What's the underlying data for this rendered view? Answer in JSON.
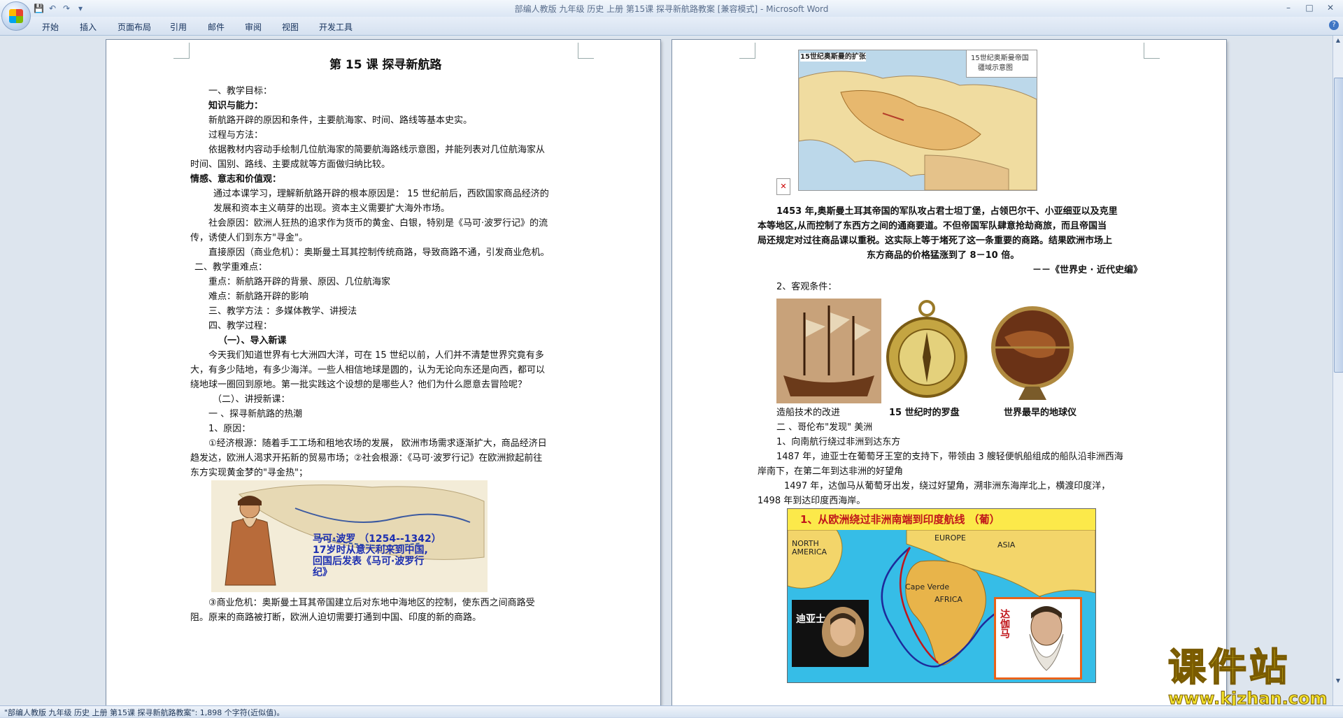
{
  "titlebar": {
    "title": "部编人教版 九年级 历史  上册 第15课  探寻新航路教案 [兼容模式] - Microsoft Word",
    "minimize": "–",
    "maximize": "□",
    "close": "✕"
  },
  "tabs": [
    "开始",
    "插入",
    "页面布局",
    "引用",
    "邮件",
    "审阅",
    "视图",
    "开发工具"
  ],
  "status": "\"部编人教版 九年级 历史  上册 第15课  探寻新航路教案\": 1,898 个字符(近似值)。",
  "watermark": {
    "name": "课件站",
    "url": "www.kjzhan.com"
  },
  "left_page": {
    "title": "第 15 课   探寻新航路",
    "lines": [
      "一、教学目标：",
      "知识与能力：",
      "新航路开辟的原因和条件，主要航海家、时间、路线等基本史实。",
      "过程与方法：",
      "依据教材内容动手绘制几位航海家的简要航海路线示意图，并能列表对几位航海家从",
      "时间、国别、路线、主要成就等方面做归纳比较。",
      "情感、意志和价值观：",
      "通过本课学习，理解新航路开辟的根本原因是：  15 世纪前后，西欧国家商品经济的",
      "发展和资本主义萌芽的出现。资本主义需要扩大海外市场。",
      "社会原因：欧洲人狂热的追求作为货币的黄金、白银，特别是《马可·波罗行记》的流",
      "传，诱使人们到东方\"寻金\"。",
      "直接原因（商业危机）：奥斯曼土耳其控制传统商路，导致商路不通，引发商业危机。",
      "二、教学重难点：",
      "重点：新航路开辟的背景、原因、几位航海家",
      "难点：新航路开辟的影响",
      "三、教学方法 ：多媒体教学、讲授法",
      "四、教学过程：",
      "（一）、导入新课",
      "今天我们知道世界有七大洲四大洋，可在 15 世纪以前，人们并不清楚世界究竟有多",
      "大，有多少陆地，有多少海洋。一些人相信地球是圆的，认为无论向东还是向西，都可以",
      "绕地球一圈回到原地。第一批实践这个设想的是哪些人？他们为什么愿意去冒险呢？",
      "（二）、讲授新课：",
      "一  、探寻新航路的热潮",
      "1、原因：",
      "①经济根源：随着手工工场和租地农场的发展，  欧洲市场需求逐渐扩大，商品经济日",
      "趋发达，欧洲人渴求开拓新的贸易市场；②社会根源：《马可·波罗行记》在欧洲掀起前往",
      "东方实现黄金梦的\"寻金热\"；",
      "③商业危机：奥斯曼土耳其帝国建立后对东地中海地区的控制，使东西之间商路受",
      "阻。原来的商路被打断，欧洲人迫切需要打通到中国、印度的新的商路。"
    ],
    "marco_polo_caption": [
      "马可·波罗 （1254--1342）",
      "17岁时从意大利来到中国,",
      "回国后发表《马可·波罗行",
      "纪》"
    ]
  },
  "right_page": {
    "map_labels": {
      "top_left": "15世纪奥斯曼的扩张",
      "top_right_1": "15世纪奥斯曼帝国",
      "top_right_2": "疆域示意图"
    },
    "quote": [
      "1453 年,奥斯曼土耳其帝国的军队攻占君士坦丁堡，占领巴尔干、小亚细亚以及克里",
      "本等地区,从而控制了东西方之间的通商要道。不但帝国军队肆意抢劫商旅，而且帝国当",
      "局还规定对过往商品课以重税。这实际上等于堵死了这一条重要的商路。结果欧洲市场上",
      "东方商品的价格猛涨到了 8－10 倍。"
    ],
    "source": "－－《世界史 · 近代史编》",
    "lines": [
      "2、客观条件：",
      "造船技术的改进",
      "15 世纪时的罗盘",
      "世界最早的地球仪",
      "二  、哥伦布\"发现\" 美洲",
      "1、向南航行绕过非洲到达东方",
      "1487 年，迪亚士在葡萄牙王室的支持下，带领由 3 艘轻便帆船组成的船队沿非洲西海",
      "岸南下，在第二年到达非洲的好望角",
      "1497 年，达伽马从葡萄牙出发，绕过好望角，溯非洲东海岸北上，横渡印度洋，",
      "1498 年到达印度西海岸。"
    ],
    "route_map": {
      "title": "1、从欧洲绕过非洲南端到印度航线  （葡）",
      "north_america": "NORTH\nAMERICA",
      "europe": "EUROPE",
      "asia": "ASIA",
      "cape_verde": "Cape Verde",
      "africa": "AFRICA",
      "dias": "迪亚士",
      "da_gama": "达伽马"
    }
  }
}
